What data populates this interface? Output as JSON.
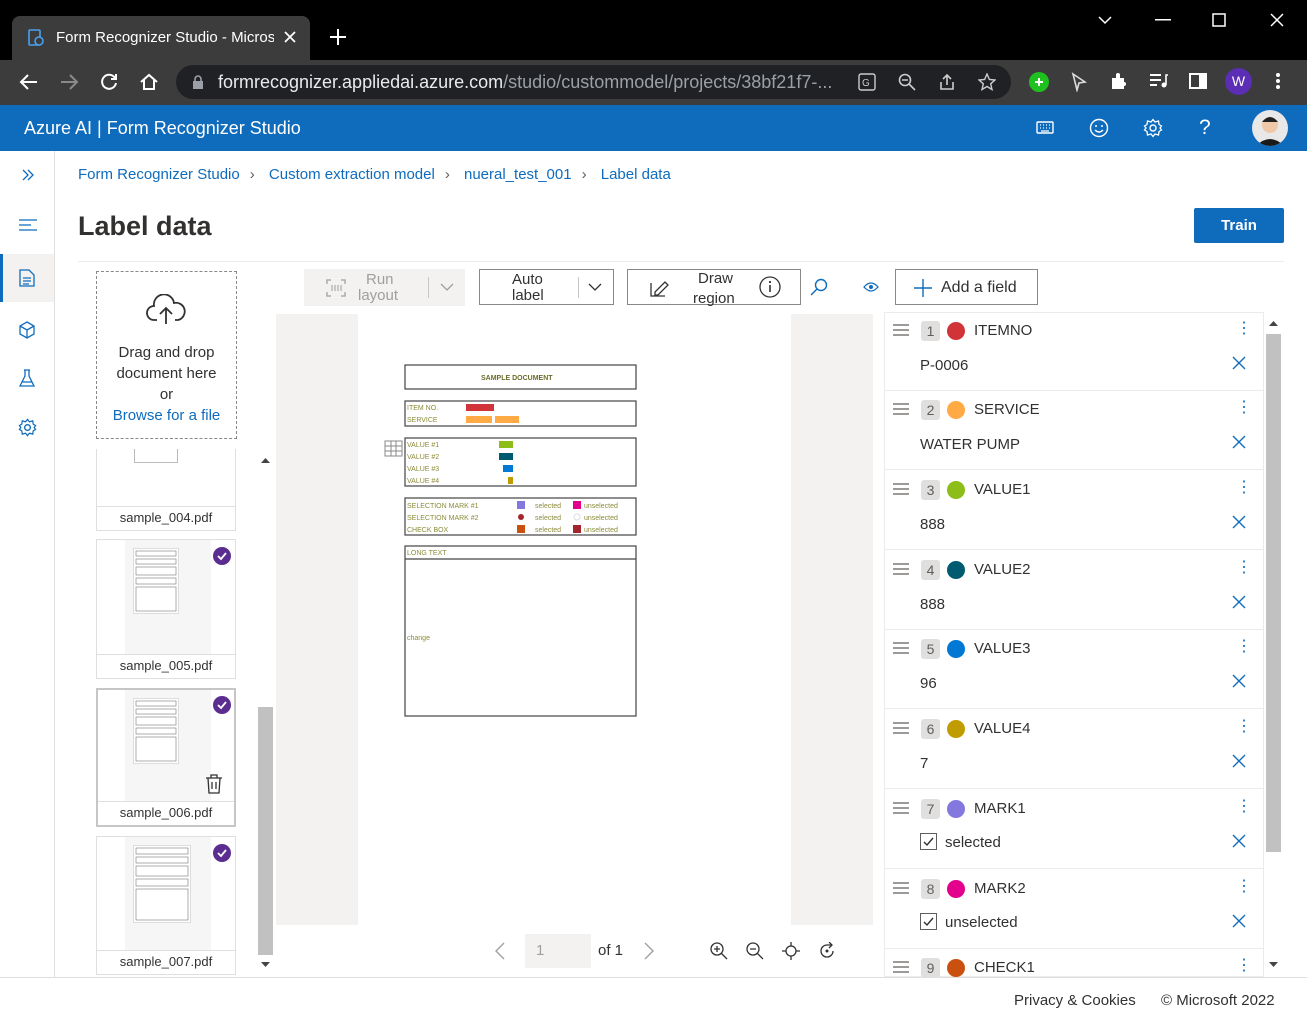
{
  "browser": {
    "tab_title": "Form Recognizer Studio - Microsoft",
    "url_host": "formrecognizer.appliedai.azure.com",
    "url_path": "/studio/custommodel/projects/38bf21f7-...",
    "profile_initial": "W"
  },
  "app": {
    "brand": "Azure AI | Form Recognizer Studio"
  },
  "breadcrumb": [
    "Form Recognizer Studio",
    "Custom extraction model",
    "nueral_test_001",
    "Label data"
  ],
  "page_title": "Label data",
  "train_label": "Train",
  "dropzone": {
    "line1": "Drag and drop",
    "line2": "document here",
    "line3": "or",
    "link": "Browse for a file"
  },
  "files": [
    {
      "name": "sample_004.pdf",
      "labeled": false
    },
    {
      "name": "sample_005.pdf",
      "labeled": true
    },
    {
      "name": "sample_006.pdf",
      "labeled": true,
      "selected": true
    },
    {
      "name": "sample_007.pdf",
      "labeled": true
    }
  ],
  "toolbar": {
    "run_layout_1": "Run",
    "run_layout_2": "layout",
    "auto_label_1": "Auto",
    "auto_label_2": "label",
    "draw_region_1": "Draw",
    "draw_region_2": "region",
    "add_field": "Add a field"
  },
  "document": {
    "title": "SAMPLE DOCUMENT",
    "item_no": "ITEM NO.",
    "service": "SERVICE",
    "values": [
      "VALUE #1",
      "VALUE #2",
      "VALUE #3",
      "VALUE #4"
    ],
    "sel1": "SELECTION MARK #1",
    "sel2": "SELECTION MARK #2",
    "checkbox": "CHECK BOX",
    "selected": "selected",
    "unselected": "unselected",
    "long_text": "LONG TEXT",
    "change": "change"
  },
  "pager": {
    "page": "1",
    "of": "of 1"
  },
  "fields": [
    {
      "num": "1",
      "name": "ITEMNO",
      "color": "#d13438",
      "value": "P-0006",
      "type": "text"
    },
    {
      "num": "2",
      "name": "SERVICE",
      "color": "#ffaa44",
      "value": "WATER PUMP",
      "type": "text"
    },
    {
      "num": "3",
      "name": "VALUE1",
      "color": "#8cbd18",
      "value": "888",
      "type": "text"
    },
    {
      "num": "4",
      "name": "VALUE2",
      "color": "#005b70",
      "value": "888",
      "type": "text"
    },
    {
      "num": "5",
      "name": "VALUE3",
      "color": "#0078d4",
      "value": "96",
      "type": "text"
    },
    {
      "num": "6",
      "name": "VALUE4",
      "color": "#c19c00",
      "value": "7",
      "type": "text"
    },
    {
      "num": "7",
      "name": "MARK1",
      "color": "#8378de",
      "value": "selected",
      "type": "mark"
    },
    {
      "num": "8",
      "name": "MARK2",
      "color": "#e3008c",
      "value": "unselected",
      "type": "mark"
    },
    {
      "num": "9",
      "name": "CHECK1",
      "color": "#ca5010",
      "value": "",
      "type": "mark"
    }
  ],
  "footer": {
    "privacy": "Privacy & Cookies",
    "copyright": "© Microsoft 2022"
  }
}
